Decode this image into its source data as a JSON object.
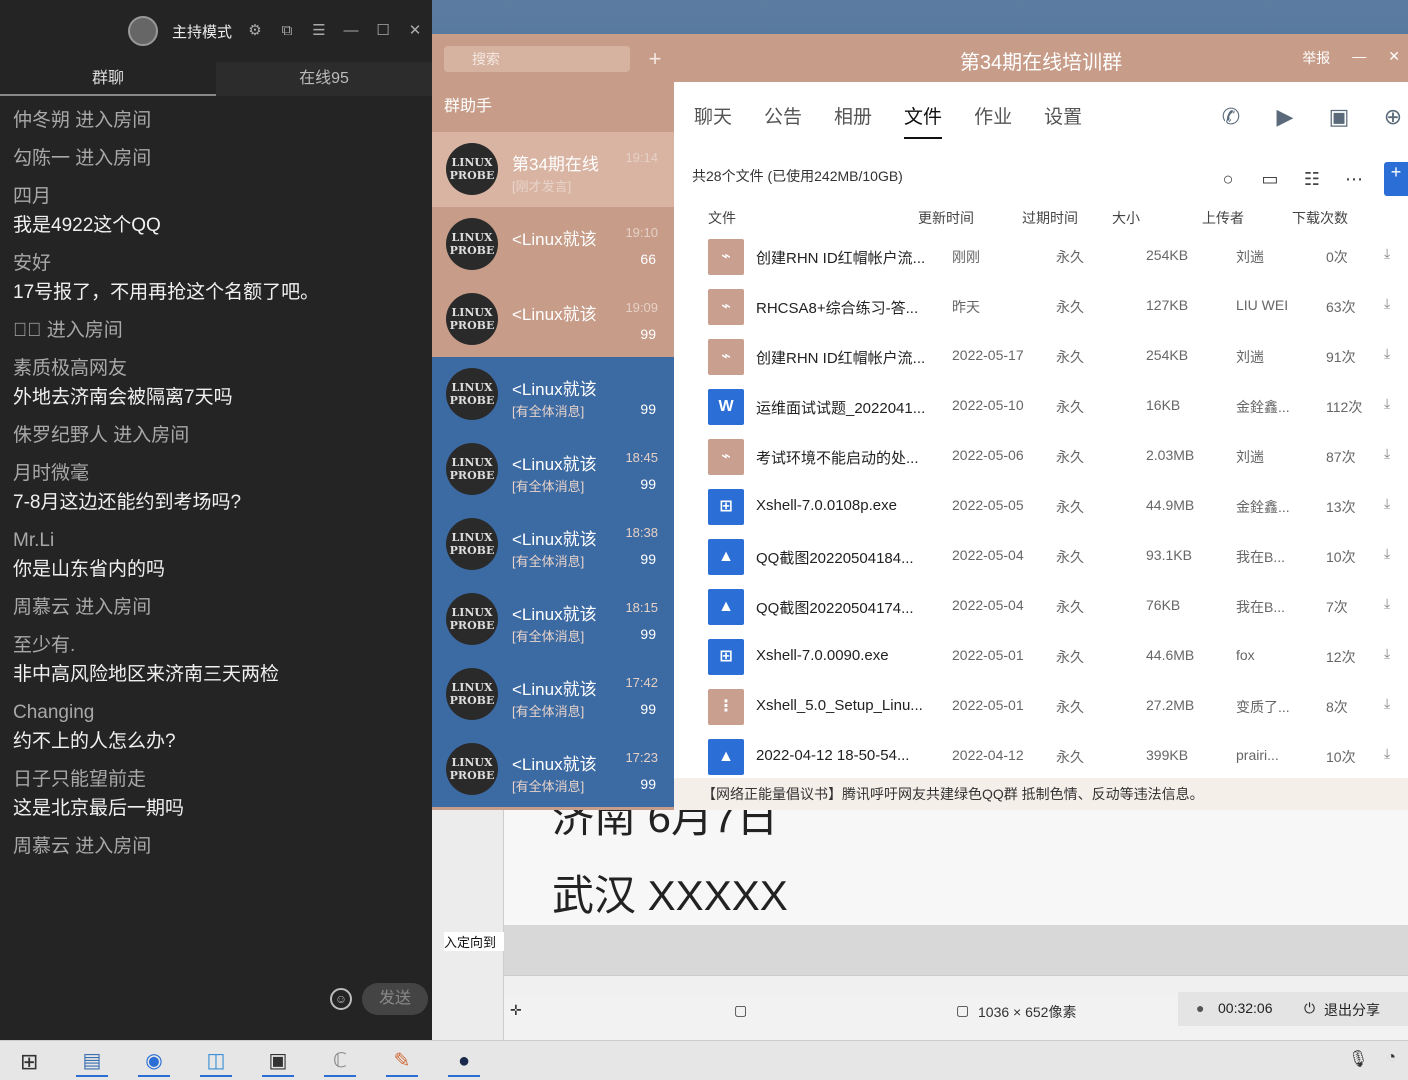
{
  "live_panel": {
    "host_mode_label": "主持模式",
    "tabs": [
      "群聊",
      "在线95"
    ],
    "messages": [
      {
        "name": "仲冬朔 进入房间",
        "text": ""
      },
      {
        "name": "勾陈一 进入房间",
        "text": ""
      },
      {
        "name": "四月",
        "text": "我是4922这个QQ"
      },
      {
        "name": "安好",
        "text": "17号报了，不用再抢这个名额了吧。"
      },
      {
        "name": "❁⃘ 进入房间",
        "text": ""
      },
      {
        "name": "素质极高网友",
        "text": "外地去济南会被隔离7天吗"
      },
      {
        "name": "侏罗纪野人 进入房间",
        "text": ""
      },
      {
        "name": "月时微毫",
        "text": "7-8月这边还能约到考场吗?"
      },
      {
        "name": "Mr.Li",
        "text": "你是山东省内的吗"
      },
      {
        "name": "周慕云 进入房间",
        "text": ""
      },
      {
        "name": "至少有.",
        "text": "非中高风险地区来济南三天两检"
      },
      {
        "name": "Changing",
        "text": "约不上的人怎么办?"
      },
      {
        "name": "日子只能望前走",
        "text": "这是北京最后一期吗"
      },
      {
        "name": "周慕云 进入房间",
        "text": ""
      }
    ],
    "send_label": "发送"
  },
  "qq": {
    "search_placeholder": "搜索",
    "helper_label": "群助手",
    "group_title": "第34期在线培训群",
    "header_right": "举报",
    "conversations": [
      {
        "name": "第34期在线",
        "time": "19:14",
        "sub": "[刚才发言]",
        "badge": "",
        "style": "sel"
      },
      {
        "name": "<Linux就该",
        "time": "19:10",
        "sub": "",
        "badge": "66",
        "style": ""
      },
      {
        "name": "<Linux就该",
        "time": "19:09",
        "sub": "",
        "badge": "99",
        "style": ""
      },
      {
        "name": "<Linux就该",
        "time": "",
        "sub": "[有全体消息]",
        "badge": "99",
        "style": "blue"
      },
      {
        "name": "<Linux就该",
        "time": "18:45",
        "sub": "[有全体消息]",
        "badge": "99",
        "style": "blue"
      },
      {
        "name": "<Linux就该",
        "time": "18:38",
        "sub": "[有全体消息]",
        "badge": "99",
        "style": "blue"
      },
      {
        "name": "<Linux就该",
        "time": "18:15",
        "sub": "[有全体消息]",
        "badge": "99",
        "style": "blue"
      },
      {
        "name": "<Linux就该",
        "time": "17:42",
        "sub": "[有全体消息]",
        "badge": "99",
        "style": "blue"
      },
      {
        "name": "<Linux就该",
        "time": "17:23",
        "sub": "[有全体消息]",
        "badge": "99",
        "style": "blue"
      }
    ],
    "tabs": [
      "聊天",
      "公告",
      "相册",
      "文件",
      "作业",
      "设置"
    ],
    "summary": "共28个文件 (已使用242MB/10GB)",
    "columns": [
      "文件",
      "更新时间",
      "过期时间",
      "大小",
      "上传者",
      "下载次数"
    ],
    "files": [
      {
        "icon": "pdf",
        "name": "创建RHN ID红帽帐户流...",
        "updated": "刚刚",
        "expire": "永久",
        "size": "254KB",
        "uploader": "刘遄",
        "downloads": "0次"
      },
      {
        "icon": "pdf",
        "name": "RHCSA8+综合练习-答...",
        "updated": "昨天",
        "expire": "永久",
        "size": "127KB",
        "uploader": "LIU WEI",
        "downloads": "63次"
      },
      {
        "icon": "pdf",
        "name": "创建RHN ID红帽帐户流...",
        "updated": "2022-05-17",
        "expire": "永久",
        "size": "254KB",
        "uploader": "刘遄",
        "downloads": "91次"
      },
      {
        "icon": "word",
        "name": "运维面试试题_2022041...",
        "updated": "2022-05-10",
        "expire": "永久",
        "size": "16KB",
        "uploader": "金銓鑫...",
        "downloads": "112次"
      },
      {
        "icon": "pdf",
        "name": "考试环境不能启动的处...",
        "updated": "2022-05-06",
        "expire": "永久",
        "size": "2.03MB",
        "uploader": "刘遄",
        "downloads": "87次"
      },
      {
        "icon": "exe",
        "name": "Xshell-7.0.0108p.exe",
        "updated": "2022-05-05",
        "expire": "永久",
        "size": "44.9MB",
        "uploader": "金銓鑫...",
        "downloads": "13次"
      },
      {
        "icon": "img",
        "name": "QQ截图20220504184...",
        "updated": "2022-05-04",
        "expire": "永久",
        "size": "93.1KB",
        "uploader": "我在B...",
        "downloads": "10次"
      },
      {
        "icon": "img",
        "name": "QQ截图20220504174...",
        "updated": "2022-05-04",
        "expire": "永久",
        "size": "76KB",
        "uploader": "我在B...",
        "downloads": "7次"
      },
      {
        "icon": "exe",
        "name": "Xshell-7.0.0090.exe",
        "updated": "2022-05-01",
        "expire": "永久",
        "size": "44.6MB",
        "uploader": "fox",
        "downloads": "12次"
      },
      {
        "icon": "zip",
        "name": "Xshell_5.0_Setup_Linu...",
        "updated": "2022-05-01",
        "expire": "永久",
        "size": "27.2MB",
        "uploader": "变质了...",
        "downloads": "8次"
      },
      {
        "icon": "img",
        "name": "2022-04-12 18-50-54...",
        "updated": "2022-04-12",
        "expire": "永久",
        "size": "399KB",
        "uploader": "prairi...",
        "downloads": "10次"
      }
    ],
    "notice": "【网络正能量倡议书】腾讯呼吁网友共建绿色QQ群 抵制色情、反动等违法信息。"
  },
  "document": {
    "line1": "济南  6月7日",
    "line2": "武汉  XXXXX",
    "redirect_text": "入定向到",
    "dimensions": "1036 × 652像素",
    "timer": "00:32:06",
    "exit_share": "退出分享"
  },
  "colors": {
    "qq_side": "#c79c88",
    "accent": "#2b6fd6"
  }
}
